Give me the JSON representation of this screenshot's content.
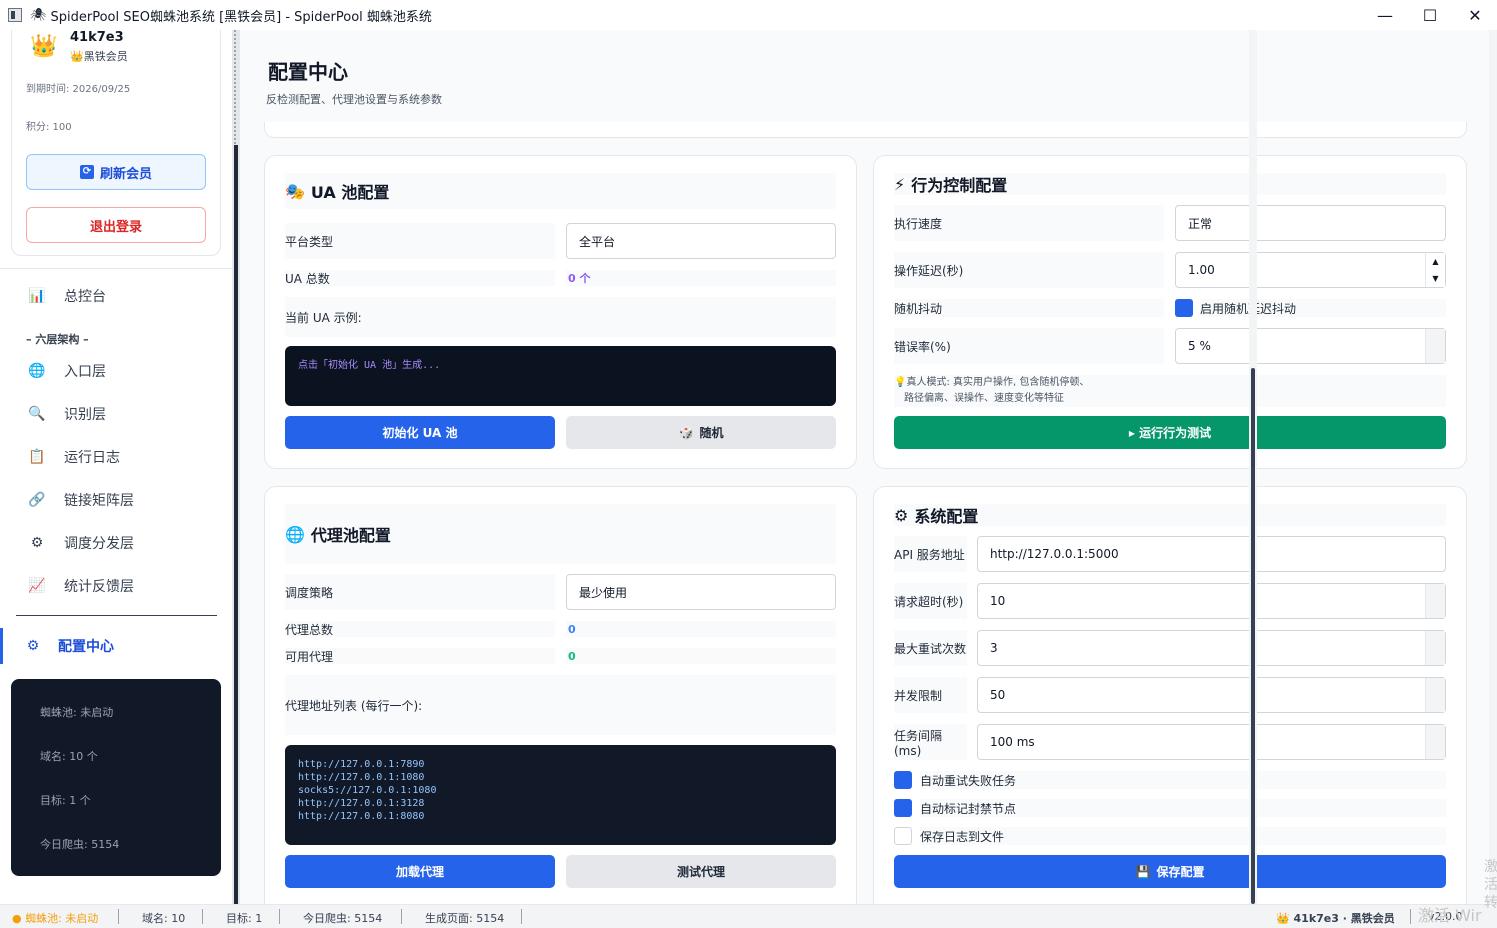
{
  "window": {
    "title": "SpiderPool SEO蜘蛛池系统 [黑铁会员] - SpiderPool 蜘蛛池系统",
    "min_glyph": "—",
    "max_glyph": "☐",
    "close_glyph": "✕"
  },
  "sidebar": {
    "user_name": "41k7e3",
    "level": "👑黑铁会员",
    "expire": "到期时间: 2026/09/25",
    "points": "积分: 100",
    "refresh_label": "刷新会员",
    "logout_label": "退出登录",
    "nav_dashboard": "总控台",
    "group_label": "– 六层架构 –",
    "nav": [
      {
        "label": "入口层",
        "icon": "🌐"
      },
      {
        "label": "识别层",
        "icon": "🔍"
      },
      {
        "label": "运行日志",
        "icon": "📋"
      },
      {
        "label": "链接矩阵层",
        "icon": "🔗"
      },
      {
        "label": "调度分发层",
        "icon": "⚙"
      },
      {
        "label": "统计反馈层",
        "icon": "📈"
      }
    ],
    "nav_config": "配置中心",
    "status": {
      "pool": "蜘蛛池: 未启动",
      "domains": "域名: 10 个",
      "targets": "目标: 1 个",
      "today": "今日爬虫: 5154"
    }
  },
  "page": {
    "title": "配置中心",
    "subtitle": "反检测配置、代理池设置与系统参数"
  },
  "ua": {
    "title": "UA 池配置",
    "platform_label": "平台类型",
    "platform_value": "全平台",
    "total_label": "UA 总数",
    "total_value": "0 个",
    "example_label": "当前 UA 示例:",
    "example_text": "点击「初始化 UA 池」生成...",
    "init_label": "初始化 UA 池",
    "random_label": "随机"
  },
  "proxy": {
    "title": "代理池配置",
    "strategy_label": "调度策略",
    "strategy_value": "最少使用",
    "total_label": "代理总数",
    "total_value": "0",
    "avail_label": "可用代理",
    "avail_value": "0",
    "list_label": "代理地址列表 (每行一个):",
    "list": [
      "http://127.0.0.1:7890",
      "http://127.0.0.1:1080",
      "socks5://127.0.0.1:1080",
      "http://127.0.0.1:3128",
      "http://127.0.0.1:8080"
    ],
    "load_label": "加载代理",
    "test_label": "测试代理"
  },
  "behavior": {
    "title": "行为控制配置",
    "speed_label": "执行速度",
    "speed_value": "正常",
    "delay_label": "操作延迟(秒)",
    "delay_value": "1.00",
    "jitter_label": "随机抖动",
    "jitter_text": "启用随机延迟抖动",
    "error_label": "错误率(%)",
    "error_value": "5 %",
    "tip_line1": "💡真人模式: 真实用户操作, 包含随机停顿、",
    "tip_line2": "路径偏离、误操作、速度变化等特征",
    "run_label": "▸ 运行行为测试"
  },
  "system": {
    "title": "系统配置",
    "api_label": "API 服务地址",
    "api_value": "http://127.0.0.1:5000",
    "timeout_label": "请求超时(秒)",
    "timeout_value": "10",
    "retry_label": "最大重试次数",
    "retry_value": "3",
    "concurrency_label": "并发限制",
    "concurrency_value": "50",
    "interval_label": "任务间隔(ms)",
    "interval_value": "100 ms",
    "opt_retry": "自动重试失败任务",
    "opt_mark": "自动标记封禁节点",
    "opt_log": "保存日志到文件",
    "save_label": "保存配置"
  },
  "statusbar": {
    "pool": "● 蜘蛛池: 未启动",
    "domains": "域名: 10",
    "targets": "目标: 1",
    "today": "今日爬虫: 5154",
    "pages": "生成页面: 5154",
    "user": "👑 41k7e3 · 黑铁会员",
    "version": "v2.0.0"
  },
  "watermark": {
    "text": "激活 Wir",
    "side": "激活转"
  },
  "colors": {
    "accent": "#2563eb",
    "success": "#059669",
    "danger": "#dc2626",
    "warning": "#f59e0b"
  }
}
